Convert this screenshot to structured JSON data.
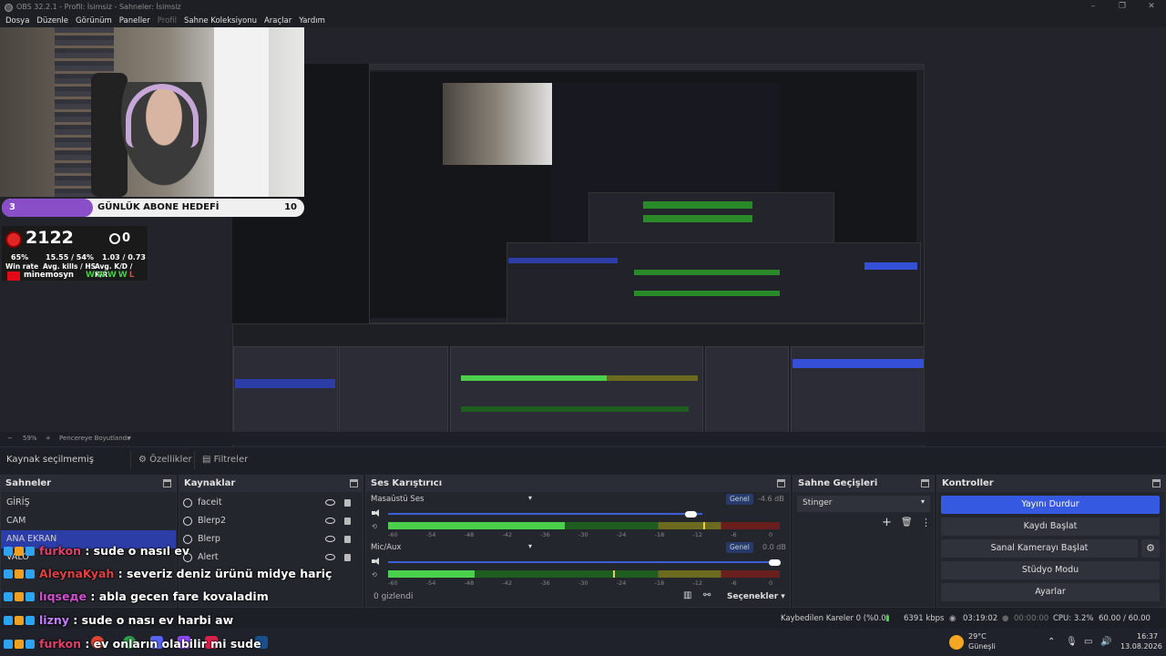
{
  "window": {
    "title": "OBS 32.2.1 - Profil: İsimsiz - Sahneler: İsimsiz"
  },
  "menu": [
    "Dosya",
    "Düzenle",
    "Görünüm",
    "Paneller",
    "Profil",
    "Sahne Koleksiyonu",
    "Araçlar",
    "Yardım"
  ],
  "overlay": {
    "goal_number": "3",
    "goal_label": "GÜNLÜK ABONE HEDEFİ",
    "goal_count": "10",
    "goal_progress": 0.3,
    "elo": "2122",
    "kills": "0",
    "winrate": "65%",
    "winrate_label": "Win rate",
    "kills_hs": "15.55 / 54%",
    "kills_hs_label": "Avg. kills / HS",
    "kd": "1.03 / 0.73",
    "kd_label": "Avg. K/D / K/R",
    "player": "minemosyn",
    "streak": "WWWW",
    "streak_loss": "L"
  },
  "zoom": {
    "percent": "59%",
    "minus": "−",
    "plus": "+",
    "mode": "Pencereye Boyutlandır"
  },
  "source_bar": {
    "no_source": "Kaynak seçilmemiş",
    "properties": "Özellikler",
    "filters": "Filtreler"
  },
  "scenes": {
    "title": "Sahneler",
    "items": [
      "GİRİŞ",
      "CAM",
      "ANA EKRAN",
      "VALO"
    ],
    "selected": 2
  },
  "sources": {
    "title": "Kaynaklar",
    "items": [
      "faceit",
      "Blerp2",
      "Blerp",
      "Alert"
    ]
  },
  "mixer": {
    "title": "Ses Karıştırıcı",
    "channels": [
      {
        "name": "Masaüstü Ses",
        "mode": "Genel",
        "db": "-4.6 dB",
        "volume": 0.98,
        "level": 0.45,
        "peak": 0.98
      },
      {
        "name": "Mic/Aux",
        "mode": "Genel",
        "db": "0.0 dB",
        "volume": 1.0,
        "level": 0.22,
        "peak": 0.7
      }
    ],
    "ticks": [
      "-60",
      "-54",
      "-48",
      "-42",
      "-36",
      "-30",
      "-24",
      "-18",
      "-12",
      "-6",
      "0"
    ],
    "hidden": "0 gizlendi",
    "options": "Seçenekler"
  },
  "transitions": {
    "title": "Sahne Geçişleri",
    "selected": "Stinger"
  },
  "controls": {
    "title": "Kontroller",
    "stop_stream": "Yayını Durdur",
    "start_record": "Kaydı Başlat",
    "virtual_cam": "Sanal Kamerayı Başlat",
    "studio_mode": "Stüdyo Modu",
    "settings": "Ayarlar"
  },
  "status": {
    "dropped": "Kaybedilen Kareler 0 (%0.0)",
    "bitrate": "6391 kbps",
    "stream_time": "03:19:02",
    "record_time": "00:00:00",
    "cpu": "CPU: 3.2%",
    "fps": "60.00 / 60.00 FPS"
  },
  "chat": [
    {
      "user": "furkon",
      "msg": ": sude o nasıl ev",
      "color": "#e0406a"
    },
    {
      "user": "AleynaKyah",
      "msg": ": severiz deniz ürünü midye hariç",
      "color": "#e04040"
    },
    {
      "user": "lıqseде",
      "msg": ": abla gecen fare kovaladim",
      "color": "#d050d0"
    },
    {
      "user": "lizny",
      "msg": ": sude o nası ev harbi aw",
      "color": "#c080ff"
    },
    {
      "user": "furkon",
      "msg": ": ev onların olabilir mi sude",
      "color": "#e0406a"
    }
  ],
  "taskbar": {
    "weather_temp": "29°C",
    "weather_desc": "Güneşli",
    "time": "16:37",
    "date": "13.08.2026"
  },
  "colors": {
    "accent": "#3559e0",
    "selection": "#2d3da8",
    "background": "#1d1f26"
  }
}
